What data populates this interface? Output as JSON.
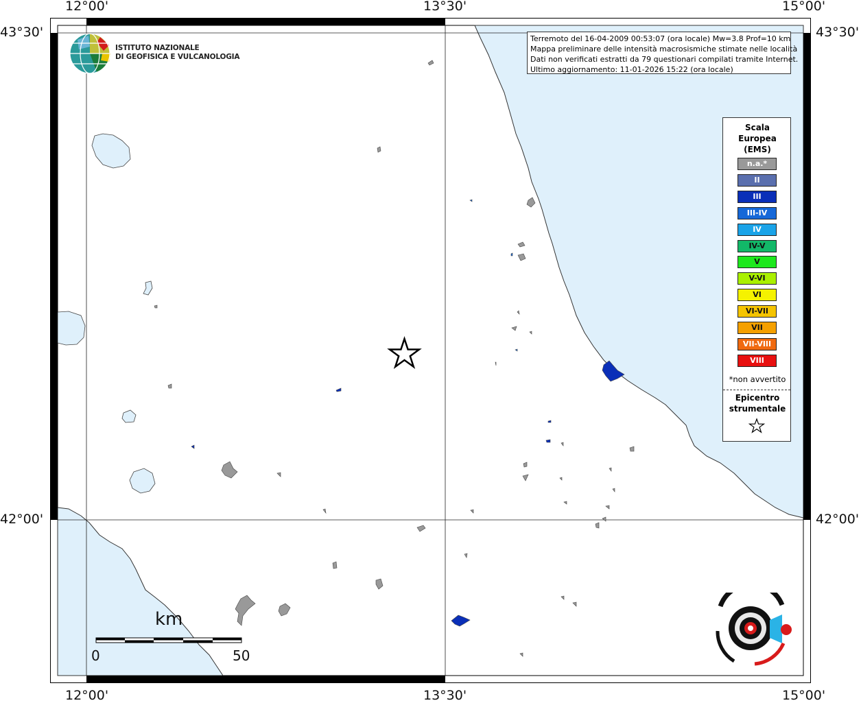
{
  "axes": {
    "lon_labels": [
      "12°00'",
      "13°30'",
      "15°00'"
    ],
    "lat_labels": [
      "43°30'",
      "42°00'"
    ]
  },
  "info": {
    "line1": "Terremoto del 16-04-2009 00:53:07 (ora locale) Mw=3.8 Prof=10 km",
    "line2": "Mappa preliminare delle intensità macrosismiche stimate nelle località",
    "line3": "Dati non verificati estratti da 79 questionari compilati tramite Internet.",
    "line4": "Ultimo aggiornamento: 11-01-2026 15:22 (ora locale)"
  },
  "logo": {
    "line1": "ISTITUTO NAZIONALE",
    "line2": "DI GEOFISICA E VULCANOLOGIA"
  },
  "legend": {
    "title": [
      "Scala",
      "Europea",
      "(EMS)"
    ],
    "classes": [
      {
        "label": "n.a.*",
        "color": "#999999"
      },
      {
        "label": "II",
        "color": "#5a6fae"
      },
      {
        "label": "III",
        "color": "#0a2fb8"
      },
      {
        "label": "III-IV",
        "color": "#1668d8"
      },
      {
        "label": "IV",
        "color": "#1aa3e8"
      },
      {
        "label": "IV-V",
        "color": "#12b868"
      },
      {
        "label": "V",
        "color": "#1de81d"
      },
      {
        "label": "V-VI",
        "color": "#aaf000"
      },
      {
        "label": "VI",
        "color": "#f5f200"
      },
      {
        "label": "VI-VII",
        "color": "#f5c400"
      },
      {
        "label": "VII",
        "color": "#f5a000"
      },
      {
        "label": "VII-VIII",
        "color": "#f06a10"
      },
      {
        "label": "VIII",
        "color": "#e81010"
      }
    ],
    "note": "*non avvertito",
    "epicenter": [
      "Epicentro",
      "strumentale"
    ]
  },
  "scalebar": {
    "unit": "km",
    "start": "0",
    "end": "50"
  },
  "colors": {
    "sea": "#dff0fb",
    "land": "#ffffff",
    "coast": "#333333"
  },
  "icons": [
    "epicenter-star-icon",
    "ingv-logo-icon",
    "hai-sentito-logo-icon"
  ]
}
